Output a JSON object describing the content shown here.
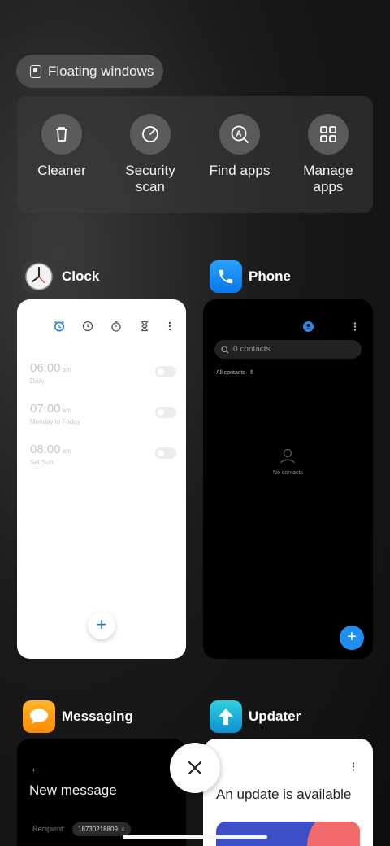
{
  "floating_windows": {
    "label": "Floating windows"
  },
  "tools": [
    {
      "label": "Cleaner",
      "icon": "trash-icon"
    },
    {
      "label": "Security\nscan",
      "icon": "security-scan-icon"
    },
    {
      "label": "Find apps",
      "icon": "find-apps-icon"
    },
    {
      "label": "Manage\napps",
      "icon": "grid-icon"
    }
  ],
  "apps": {
    "clock": {
      "name": "Clock",
      "alarms": [
        {
          "time": "06:00",
          "ampm": "am",
          "repeat": "Daily"
        },
        {
          "time": "07:00",
          "ampm": "am",
          "repeat": "Monday to Friday"
        },
        {
          "time": "08:00",
          "ampm": "am",
          "repeat": "Sat Sun"
        }
      ],
      "fab": "+"
    },
    "phone": {
      "name": "Phone",
      "search_placeholder": "0 contacts",
      "filter": "All contacts",
      "empty_text": "No contacts",
      "fab": "+"
    },
    "messaging": {
      "name": "Messaging",
      "title": "New message",
      "recipient_label": "Recipient:",
      "recipient_value": "18730218809"
    },
    "updater": {
      "name": "Updater",
      "title": "An update is available"
    }
  },
  "colors": {
    "accent_blue": "#1e8ff0",
    "clock_tab_active": "#1a7be0"
  }
}
